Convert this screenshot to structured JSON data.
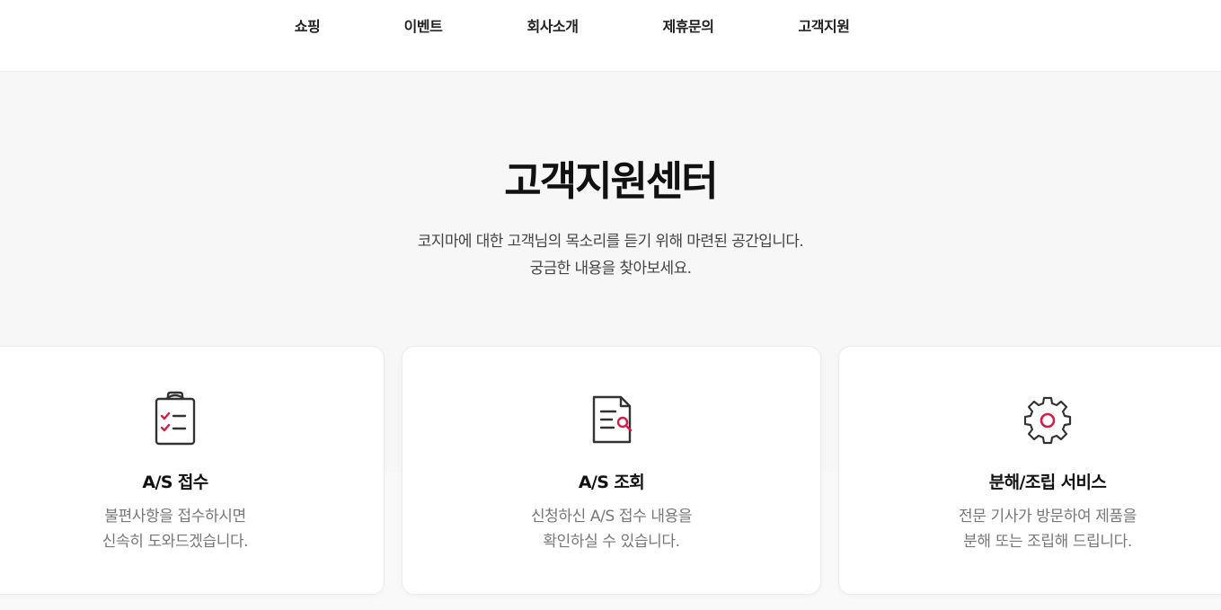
{
  "nav": {
    "items": [
      {
        "label": "쇼핑"
      },
      {
        "label": "이벤트"
      },
      {
        "label": "회사소개"
      },
      {
        "label": "제휴문의"
      },
      {
        "label": "고객지원"
      }
    ]
  },
  "hero": {
    "title": "고객지원센터",
    "desc_line1": "코지마에 대한 고객님의 목소리를 듣기 위해 마련된 공간입니다.",
    "desc_line2": "궁금한 내용을 찾아보세요."
  },
  "cards": [
    {
      "icon": "clipboard-check-icon",
      "title": "A/S 접수",
      "desc_line1": "불편사항을 접수하시면",
      "desc_line2": "신속히 도와드겠습니다."
    },
    {
      "icon": "document-search-icon",
      "title": "A/S 조회",
      "desc_line1": "신청하신 A/S 접수 내용을",
      "desc_line2": "확인하실 수 있습니다."
    },
    {
      "icon": "gear-icon",
      "title": "분해/조립 서비스",
      "desc_line1": "전문 기사가 방문하여 제품을",
      "desc_line2": "분해 또는 조립해 드립니다."
    }
  ],
  "colors": {
    "accent": "#d21e46",
    "icon_stroke": "#333333",
    "hero_bg": "#f7f7f7"
  }
}
